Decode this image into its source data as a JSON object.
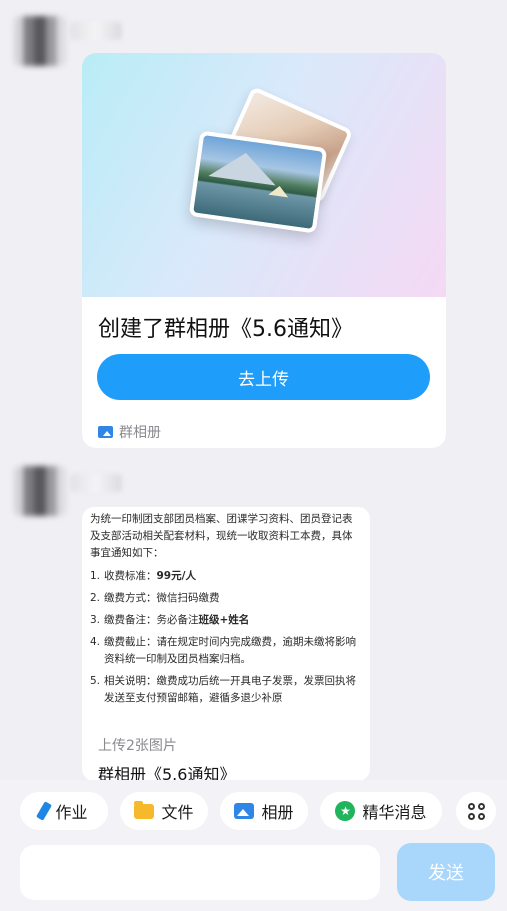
{
  "messages": [
    {
      "type": "album-card",
      "title": "创建了群相册《5.6通知》",
      "button_label": "去上传",
      "footer_label": "群相册"
    },
    {
      "type": "notice-card",
      "intro": "为统一印制团支部团员档案、团课学习资料、团员登记表及支部活动相关配套材料，现统一收取资料工本费，具体事宜通知如下：",
      "items": [
        {
          "num": "1.",
          "prefix": "收费标准：",
          "bold": "99元/人",
          "suffix": ""
        },
        {
          "num": "2.",
          "prefix": "缴费方式：微信扫码缴费",
          "bold": "",
          "suffix": ""
        },
        {
          "num": "3.",
          "prefix": "缴费备注：务必备注",
          "bold": "班级+姓名",
          "suffix": ""
        },
        {
          "num": "4.",
          "prefix": "缴费截止：请在规定时间内完成缴费，逾期未缴将影响资料统一印制及团员档案归档。",
          "bold": "",
          "suffix": ""
        },
        {
          "num": "5.",
          "prefix": "相关说明：缴费成功后统一开具电子发票，发票回执将发送至支付预留邮箱，避循多退少补原",
          "bold": "",
          "suffix": ""
        }
      ],
      "subtitle": "上传2张图片",
      "title": "群相册《5.6通知》"
    }
  ],
  "toolbar": {
    "chips": [
      {
        "label": "作业",
        "icon": "pencil-icon"
      },
      {
        "label": "文件",
        "icon": "folder-icon"
      },
      {
        "label": "相册",
        "icon": "photo-icon"
      },
      {
        "label": "精华消息",
        "icon": "star-badge-icon"
      }
    ],
    "more_icon": "grid-icon",
    "input_placeholder": "",
    "send_label": "发送"
  },
  "colors": {
    "accent": "#1e9dfb",
    "send_disabled": "#a9d6fb",
    "background": "#efeff4"
  }
}
